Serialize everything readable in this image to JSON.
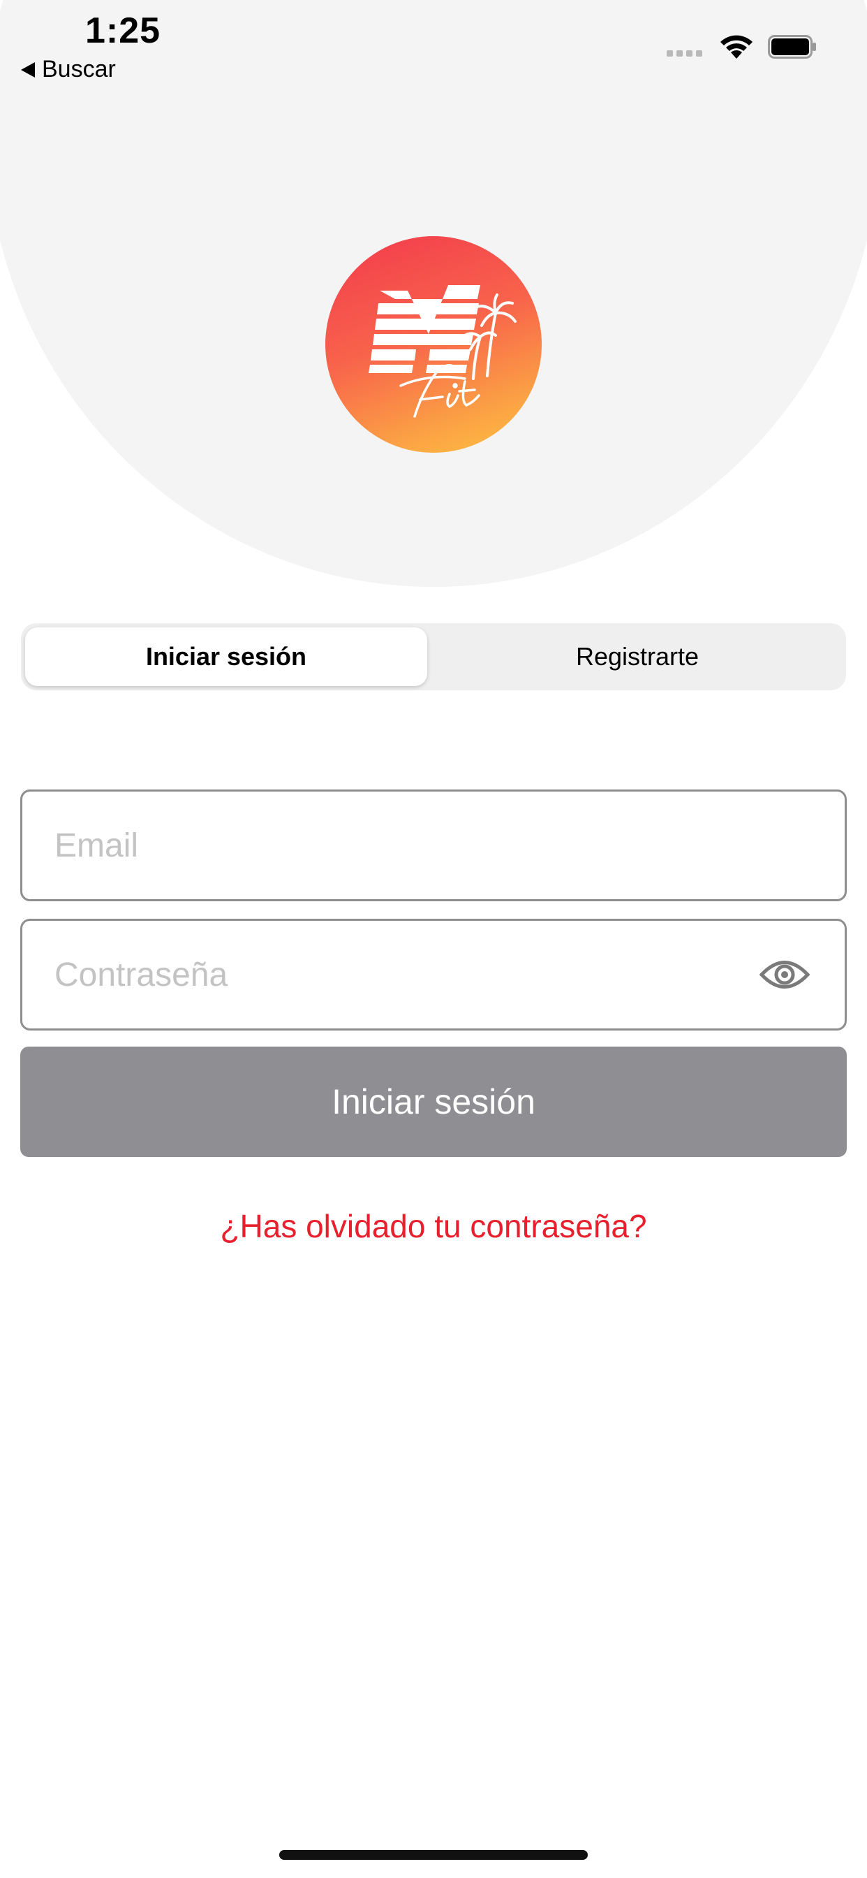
{
  "status_bar": {
    "time": "1:25",
    "back_label": "Buscar"
  },
  "logo": {
    "name": "MFit logo",
    "script_text": "Fit",
    "icon": "palm-tree-icon"
  },
  "tabs": [
    {
      "label": "Iniciar sesión",
      "active": true
    },
    {
      "label": "Registrarte",
      "active": false
    }
  ],
  "form": {
    "email_placeholder": "Email",
    "email_value": "",
    "password_placeholder": "Contraseña",
    "password_value": "",
    "submit_label": "Iniciar sesión",
    "forgot_label": "¿Has olvidado tu contraseña?"
  },
  "colors": {
    "accent_red": "#e8202d",
    "button_disabled": "#8f8f93",
    "header_bg": "#f4f4f4"
  }
}
